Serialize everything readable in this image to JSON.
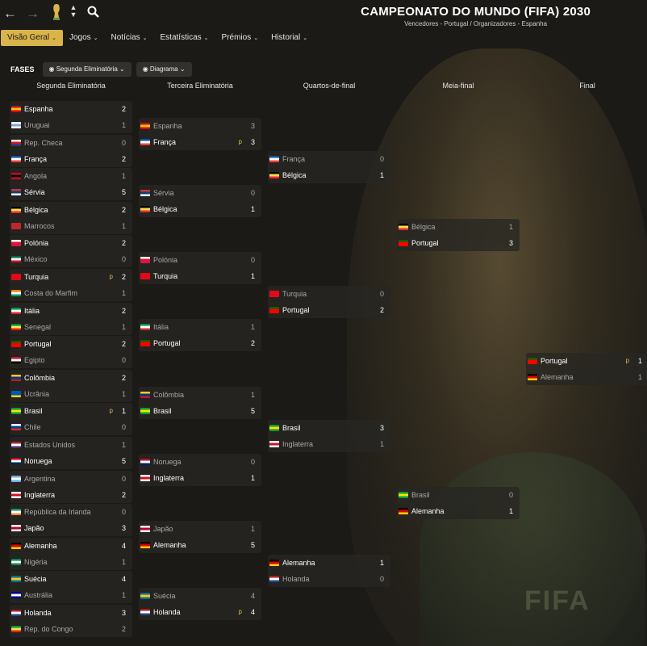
{
  "nav": {
    "back": "←",
    "forward": "→",
    "updown": "⌃⌄",
    "search": "🔍"
  },
  "header": {
    "title": "CAMPEONATO DO MUNDO (FIFA) 2030",
    "subtitle": "Vencedores - Portugal / Organizadores - Espanha"
  },
  "menu": [
    {
      "label": "Visão Geral",
      "active": true
    },
    {
      "label": "Jogos"
    },
    {
      "label": "Notícias"
    },
    {
      "label": "Estatísticas"
    },
    {
      "label": "Prémios"
    },
    {
      "label": "Historial"
    }
  ],
  "filters": {
    "label": "FASES",
    "stage": "Segunda Eliminatória",
    "view": "Diagrama"
  },
  "rounds": [
    "Segunda Eliminatória",
    "Terceira Eliminatória",
    "Quartos-de-final",
    "Meia-final",
    "Final"
  ],
  "flags": {
    "Espanha": [
      "#c60b1e",
      "#ffc400",
      "#c60b1e"
    ],
    "Uruguai": [
      "#ffffff",
      "#7aa7d8",
      "#ffffff"
    ],
    "Rep. Checa": [
      "#ffffff",
      "#d7141a",
      "#11457e"
    ],
    "França": [
      "#0055a4",
      "#ffffff",
      "#ef4135"
    ],
    "Angola": [
      "#cc092f",
      "#000000",
      "#cc092f"
    ],
    "Sérvia": [
      "#c6363c",
      "#0c4076",
      "#ffffff"
    ],
    "Bélgica": [
      "#000000",
      "#fae042",
      "#ed2939"
    ],
    "Marrocos": [
      "#c1272d",
      "#c1272d",
      "#c1272d"
    ],
    "Polónia": [
      "#ffffff",
      "#dc143c",
      "#dc143c"
    ],
    "México": [
      "#006847",
      "#ffffff",
      "#ce1126"
    ],
    "Turquia": [
      "#e30a17",
      "#e30a17",
      "#e30a17"
    ],
    "Costa do Marfim": [
      "#f77f00",
      "#ffffff",
      "#009e60"
    ],
    "Itália": [
      "#009246",
      "#ffffff",
      "#ce2b37"
    ],
    "Senegal": [
      "#00853f",
      "#fdef42",
      "#e31b23"
    ],
    "Portugal": [
      "#006600",
      "#ff0000",
      "#ff0000"
    ],
    "Egipto": [
      "#ce1126",
      "#ffffff",
      "#000000"
    ],
    "Colômbia": [
      "#fcd116",
      "#003893",
      "#ce1126"
    ],
    "Ucrânia": [
      "#0057b7",
      "#0057b7",
      "#ffd700"
    ],
    "Brasil": [
      "#009c3b",
      "#ffdf00",
      "#009c3b"
    ],
    "Chile": [
      "#ffffff",
      "#0039a6",
      "#d52b1e"
    ],
    "Estados Unidos": [
      "#b22234",
      "#ffffff",
      "#3c3b6e"
    ],
    "Noruega": [
      "#ba0c2f",
      "#ffffff",
      "#00205b"
    ],
    "Argentina": [
      "#74acdf",
      "#ffffff",
      "#74acdf"
    ],
    "Inglaterra": [
      "#ffffff",
      "#ce1124",
      "#ffffff"
    ],
    "República da Irlanda": [
      "#169b62",
      "#ffffff",
      "#ff883e"
    ],
    "Japão": [
      "#ffffff",
      "#bc002d",
      "#ffffff"
    ],
    "Alemanha": [
      "#000000",
      "#dd0000",
      "#ffce00"
    ],
    "Nigéria": [
      "#008751",
      "#ffffff",
      "#008751"
    ],
    "Suécia": [
      "#006aa7",
      "#fecc00",
      "#006aa7"
    ],
    "Austrália": [
      "#00008b",
      "#ffffff",
      "#00008b"
    ],
    "Holanda": [
      "#ae1c28",
      "#ffffff",
      "#21468b"
    ],
    "Rep. do Congo": [
      "#009543",
      "#fbde4a",
      "#dc241f"
    ]
  },
  "bracket": [
    [
      [
        [
          "Espanha",
          "2",
          ""
        ],
        [
          "Uruguai",
          "1",
          ""
        ]
      ],
      [
        [
          "Rep. Checa",
          "0",
          ""
        ],
        [
          "França",
          "2",
          ""
        ]
      ],
      [
        [
          "Angola",
          "1",
          ""
        ],
        [
          "Sérvia",
          "5",
          ""
        ]
      ],
      [
        [
          "Bélgica",
          "2",
          ""
        ],
        [
          "Marrocos",
          "1",
          ""
        ]
      ],
      [
        [
          "Polónia",
          "2",
          ""
        ],
        [
          "México",
          "0",
          ""
        ]
      ],
      [
        [
          "Turquia",
          "2",
          "p"
        ],
        [
          "Costa do Marfim",
          "1",
          ""
        ]
      ],
      [
        [
          "Itália",
          "2",
          ""
        ],
        [
          "Senegal",
          "1",
          ""
        ]
      ],
      [
        [
          "Portugal",
          "2",
          ""
        ],
        [
          "Egipto",
          "0",
          ""
        ]
      ],
      [
        [
          "Colômbia",
          "2",
          ""
        ],
        [
          "Ucrânia",
          "1",
          ""
        ]
      ],
      [
        [
          "Brasil",
          "1",
          "p"
        ],
        [
          "Chile",
          "0",
          ""
        ]
      ],
      [
        [
          "Estados Unidos",
          "1",
          ""
        ],
        [
          "Noruega",
          "5",
          ""
        ]
      ],
      [
        [
          "Argentina",
          "0",
          ""
        ],
        [
          "Inglaterra",
          "2",
          ""
        ]
      ],
      [
        [
          "República da Irlanda",
          "0",
          ""
        ],
        [
          "Japão",
          "3",
          ""
        ]
      ],
      [
        [
          "Alemanha",
          "4",
          ""
        ],
        [
          "Nigéria",
          "1",
          ""
        ]
      ],
      [
        [
          "Suécia",
          "4",
          ""
        ],
        [
          "Austrália",
          "1",
          ""
        ]
      ],
      [
        [
          "Holanda",
          "3",
          ""
        ],
        [
          "Rep. do Congo",
          "2",
          ""
        ]
      ]
    ],
    [
      [
        [
          "Espanha",
          "3",
          ""
        ],
        [
          "França",
          "3",
          "p"
        ]
      ],
      [
        [
          "Sérvia",
          "0",
          ""
        ],
        [
          "Bélgica",
          "1",
          ""
        ]
      ],
      [
        [
          "Polónia",
          "0",
          ""
        ],
        [
          "Turquia",
          "1",
          ""
        ]
      ],
      [
        [
          "Itália",
          "1",
          ""
        ],
        [
          "Portugal",
          "2",
          ""
        ]
      ],
      [
        [
          "Colômbia",
          "1",
          ""
        ],
        [
          "Brasil",
          "5",
          ""
        ]
      ],
      [
        [
          "Noruega",
          "0",
          ""
        ],
        [
          "Inglaterra",
          "1",
          ""
        ]
      ],
      [
        [
          "Japão",
          "1",
          ""
        ],
        [
          "Alemanha",
          "5",
          ""
        ]
      ],
      [
        [
          "Suécia",
          "4",
          ""
        ],
        [
          "Holanda",
          "4",
          "p"
        ]
      ]
    ],
    [
      [
        [
          "França",
          "0",
          ""
        ],
        [
          "Bélgica",
          "1",
          ""
        ]
      ],
      [
        [
          "Turquia",
          "0",
          ""
        ],
        [
          "Portugal",
          "2",
          ""
        ]
      ],
      [
        [
          "Brasil",
          "3",
          ""
        ],
        [
          "Inglaterra",
          "1",
          ""
        ]
      ],
      [
        [
          "Alemanha",
          "1",
          ""
        ],
        [
          "Holanda",
          "0",
          ""
        ]
      ]
    ],
    [
      [
        [
          "Bélgica",
          "1",
          ""
        ],
        [
          "Portugal",
          "3",
          ""
        ]
      ],
      [
        [
          "Brasil",
          "0",
          ""
        ],
        [
          "Alemanha",
          "1",
          ""
        ]
      ]
    ],
    [
      [
        [
          "Portugal",
          "1",
          "p"
        ],
        [
          "Alemanha",
          "1",
          ""
        ]
      ]
    ]
  ]
}
